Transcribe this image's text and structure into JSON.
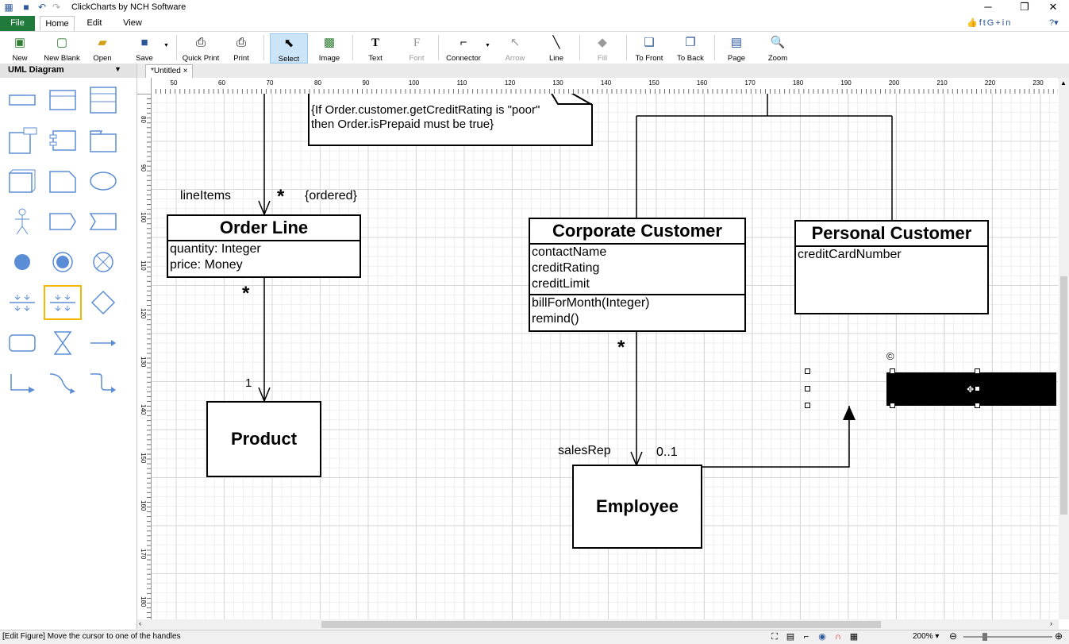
{
  "app": {
    "title": "ClickCharts by NCH Software"
  },
  "menu_tabs": [
    "File",
    "Home",
    "Edit",
    "View"
  ],
  "toolbar": {
    "new": "New",
    "new_blank": "New Blank",
    "open": "Open",
    "save": "Save",
    "quick_print": "Quick Print",
    "print": "Print",
    "select": "Select",
    "image": "Image",
    "text": "Text",
    "font": "Font",
    "connector": "Connector",
    "arrow": "Arrow",
    "line": "Line",
    "fill": "Fill",
    "to_front": "To Front",
    "to_back": "To Back",
    "page": "Page",
    "zoom": "Zoom"
  },
  "left_panel": {
    "title": "UML Diagram"
  },
  "document_tab": {
    "label": "*Untitled",
    "close": "×"
  },
  "ruler": {
    "h_labels": [
      "50",
      "60",
      "70",
      "80",
      "90",
      "100",
      "110",
      "120",
      "130",
      "140",
      "150",
      "160",
      "170",
      "180",
      "190",
      "200",
      "210",
      "220",
      "230"
    ],
    "v_labels": [
      "80",
      "90",
      "100",
      "110",
      "120",
      "130",
      "140",
      "150",
      "160",
      "170",
      "180"
    ]
  },
  "diagram": {
    "note_line1": "{If Order.customer.getCreditRating is \"poor\"",
    "note_line2": "then Order.isPrepaid must be true}",
    "label_lineitems": "lineItems",
    "label_star1": "*",
    "label_ordered": "{ordered}",
    "label_star2": "*",
    "label_one": "1",
    "label_star3": "*",
    "label_salesrep": "salesRep",
    "label_zero_one": "0..1",
    "rotate_icon": "©",
    "order_line": {
      "title": "Order Line",
      "attrs": [
        "quantity: Integer",
        "price: Money"
      ]
    },
    "product": {
      "title": "Product"
    },
    "corporate_customer": {
      "title": "Corporate Customer",
      "attrs": [
        "contactName",
        "creditRating",
        "creditLimit"
      ],
      "ops": [
        "billForMonth(Integer)",
        "remind()"
      ]
    },
    "personal_customer": {
      "title": "Personal Customer",
      "attrs": [
        "creditCardNumber"
      ]
    },
    "employee": {
      "title": "Employee"
    }
  },
  "status": {
    "message": "[Edit Figure] Move the cursor to one of the handles",
    "zoom": "200%"
  }
}
